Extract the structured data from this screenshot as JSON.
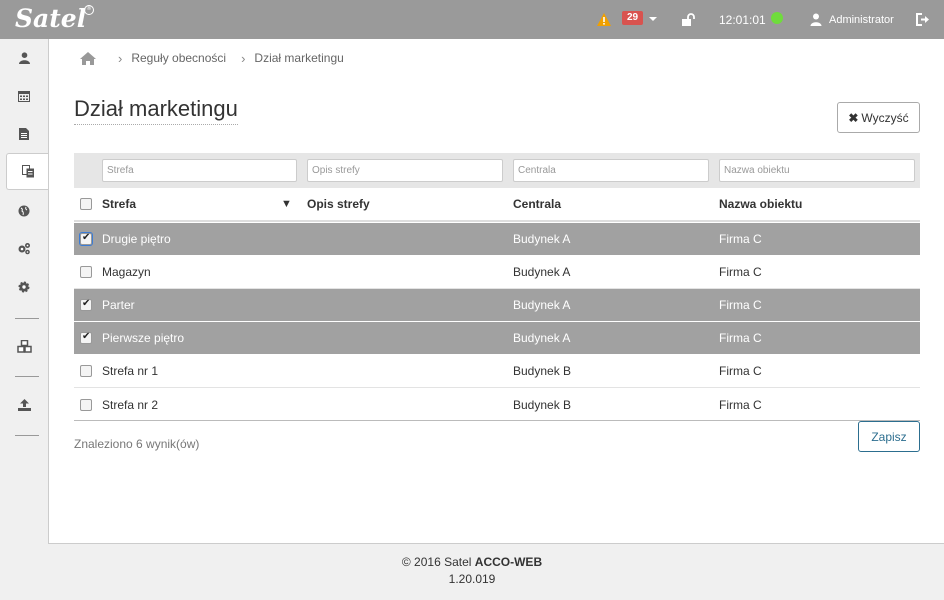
{
  "topbar": {
    "logo": "Satel",
    "logo_mark": "®",
    "alerts_count": "29",
    "time": "12:01:01",
    "user": "Administrator",
    "status_color": "#6fdc3c"
  },
  "sidebar": {
    "items": [
      {
        "icon": "user-icon"
      },
      {
        "icon": "calendar-icon"
      },
      {
        "icon": "document-icon"
      },
      {
        "icon": "copy-documents-icon",
        "active": true
      },
      {
        "icon": "globe-icon"
      },
      {
        "icon": "gears-icon"
      },
      {
        "icon": "gear-icon"
      },
      {
        "icon": "cubes-icon"
      },
      {
        "icon": "upload-icon"
      }
    ]
  },
  "breadcrumb": {
    "items": [
      "Reguły obecności",
      "Dział marketingu"
    ]
  },
  "page": {
    "title": "Dział marketingu",
    "clear_label": "Wyczyść"
  },
  "filters": {
    "strefa": "Strefa",
    "opis": "Opis strefy",
    "centrala": "Centrala",
    "obiekt": "Nazwa obiektu"
  },
  "table": {
    "headers": [
      "Strefa",
      "Opis strefy",
      "Centrala",
      "Nazwa obiektu"
    ],
    "rows": [
      {
        "strefa": "Drugie piętro",
        "opis": "",
        "centrala": "Budynek A",
        "obiekt": "Firma C",
        "checked": true
      },
      {
        "strefa": "Magazyn",
        "opis": "",
        "centrala": "Budynek A",
        "obiekt": "Firma C",
        "checked": false
      },
      {
        "strefa": "Parter",
        "opis": "",
        "centrala": "Budynek A",
        "obiekt": "Firma C",
        "checked": true
      },
      {
        "strefa": "Pierwsze piętro",
        "opis": "",
        "centrala": "Budynek A",
        "obiekt": "Firma C",
        "checked": true
      },
      {
        "strefa": "Strefa nr 1",
        "opis": "",
        "centrala": "Budynek B",
        "obiekt": "Firma C",
        "checked": false
      },
      {
        "strefa": "Strefa nr 2",
        "opis": "",
        "centrala": "Budynek B",
        "obiekt": "Firma C",
        "checked": false
      }
    ]
  },
  "results": "Znaleziono 6 wynik(ów)",
  "save_label": "Zapisz",
  "footer": {
    "copyright": "© 2016 Satel",
    "product": "ACCO-WEB",
    "version": "1.20.019"
  }
}
